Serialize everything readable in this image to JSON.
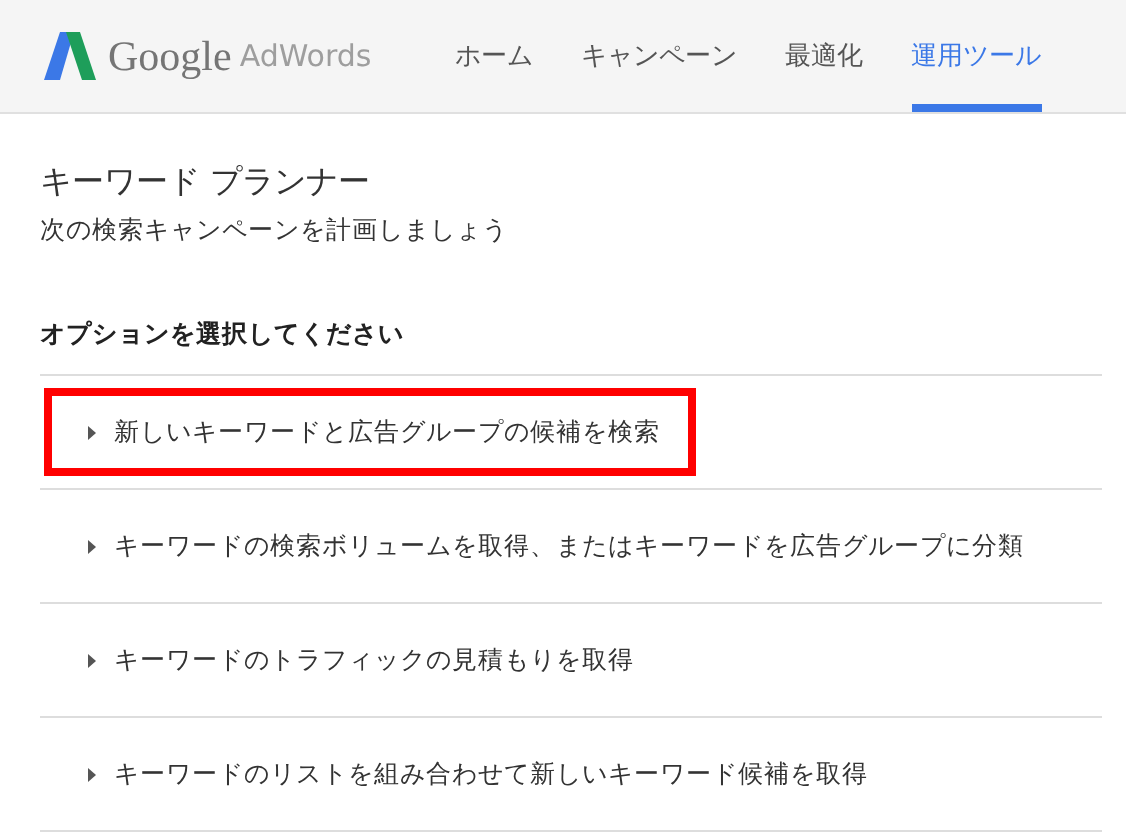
{
  "header": {
    "brand": "Google",
    "product": "AdWords",
    "nav": [
      {
        "label": "ホーム",
        "selected": false
      },
      {
        "label": "キャンペーン",
        "selected": false
      },
      {
        "label": "最適化",
        "selected": false
      },
      {
        "label": "運用ツール",
        "selected": true
      }
    ]
  },
  "page": {
    "title": "キーワード プランナー",
    "subtitle": "次の検索キャンペーンを計画しましょう"
  },
  "options": {
    "heading": "オプションを選択してください",
    "items": [
      {
        "label": "新しいキーワードと広告グループの候補を検索",
        "highlighted": true
      },
      {
        "label": "キーワードの検索ボリュームを取得、またはキーワードを広告グループに分類",
        "highlighted": false
      },
      {
        "label": "キーワードのトラフィックの見積もりを取得",
        "highlighted": false
      },
      {
        "label": "キーワードのリストを組み合わせて新しいキーワード候補を取得",
        "highlighted": false
      }
    ]
  }
}
